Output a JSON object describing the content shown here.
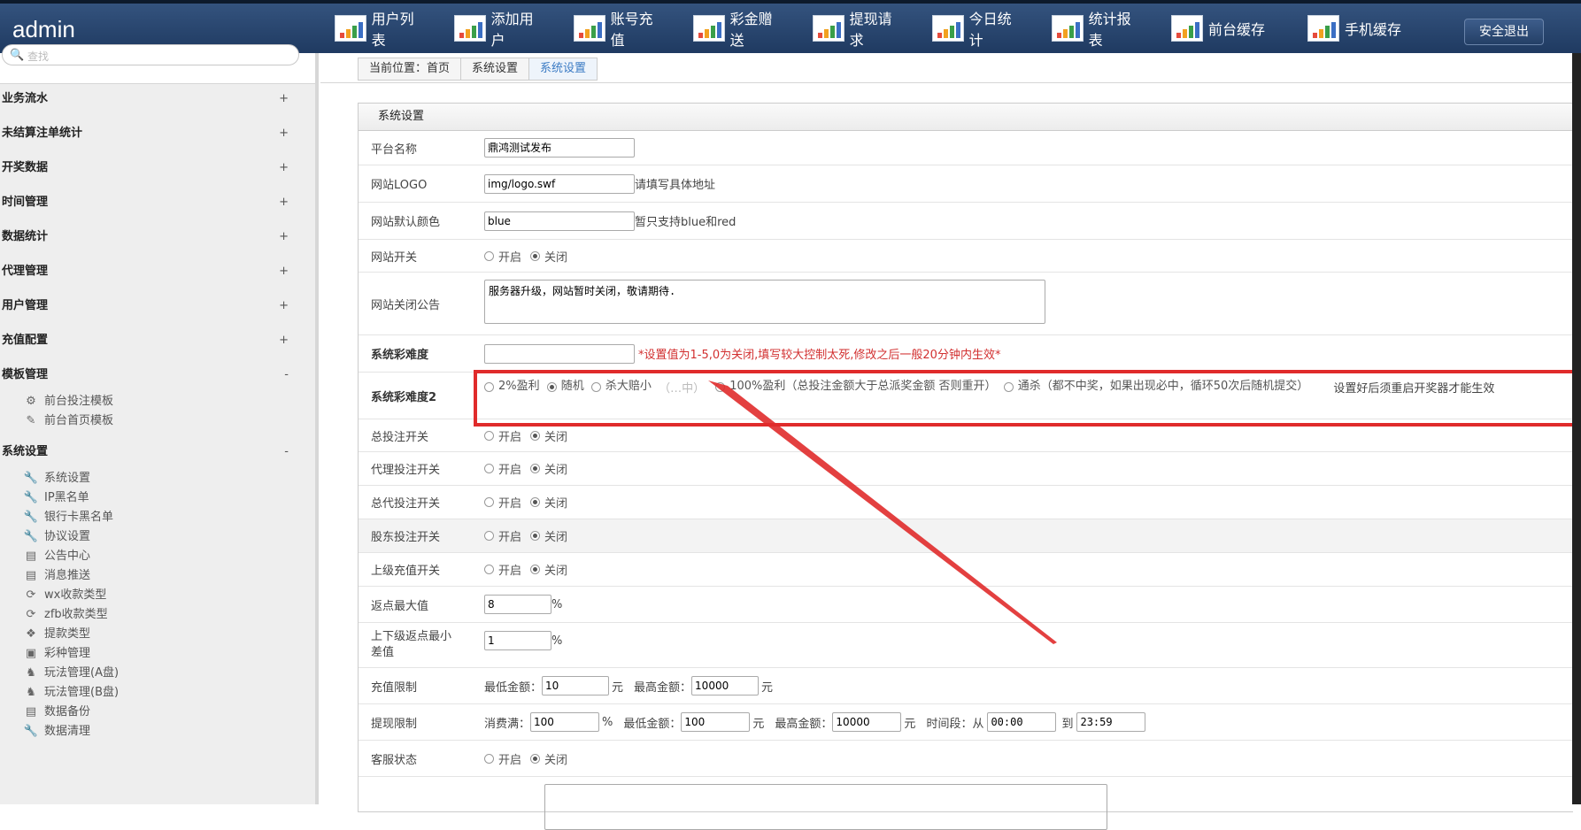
{
  "header": {
    "brand": "admin",
    "nav": [
      "用户列表",
      "添加用户",
      "账号充值",
      "彩金赠送",
      "提现请求",
      "今日统计",
      "统计报表",
      "前台缓存",
      "手机缓存"
    ],
    "logout": "安全退出"
  },
  "sidebar": {
    "search_placeholder": "查找",
    "groups": [
      {
        "label": "业务流水",
        "sign": "+"
      },
      {
        "label": "未结算注单统计",
        "sign": "+"
      },
      {
        "label": "开奖数据",
        "sign": "+"
      },
      {
        "label": "时间管理",
        "sign": "+"
      },
      {
        "label": "数据统计",
        "sign": "+"
      },
      {
        "label": "代理管理",
        "sign": "+"
      },
      {
        "label": "用户管理",
        "sign": "+"
      },
      {
        "label": "充值配置",
        "sign": "+"
      },
      {
        "label": "模板管理",
        "sign": "-"
      }
    ],
    "template_items": [
      "前台投注模板",
      "前台首页模板"
    ],
    "system_group": {
      "label": "系统设置",
      "sign": "-"
    },
    "system_items": [
      "系统设置",
      "IP黑名单",
      "银行卡黑名单",
      "协议设置",
      "公告中心",
      "消息推送",
      "wx收款类型",
      "zfb收款类型",
      "提款类型",
      "彩种管理",
      "玩法管理(A盘)",
      "玩法管理(B盘)",
      "数据备份",
      "数据清理"
    ]
  },
  "breadcrumb": [
    "当前位置：首页",
    "系统设置",
    "系统设置"
  ],
  "panel": {
    "title": "系统设置",
    "platform_name": {
      "label": "平台名称",
      "value": "鼎鸿测试发布"
    },
    "logo": {
      "label": "网站LOGO",
      "value": "img/logo.swf",
      "hint": "请填写具体地址"
    },
    "color": {
      "label": "网站默认颜色",
      "value": "blue",
      "hint": "暂只支持blue和red"
    },
    "site_switch": {
      "label": "网站开关"
    },
    "close_notice": {
      "label": "网站关闭公告",
      "value": "服务器升级，网站暂时关闭，敬请期待."
    },
    "difficulty": {
      "label": "系统彩难度",
      "hint": "*设置值为1-5,0为关闭,填写较大控制太死,修改之后一般20分钟内生效*"
    },
    "difficulty2": {
      "label": "系统彩难度2",
      "opt1": "2%盈利",
      "opt2": "随机",
      "opt3": "杀大赔小",
      "opt3_note": "（…中）",
      "opt4": "100%盈利（总投注金额大于总派奖金额 否则重开）",
      "opt5": "通杀（都不中奖，如果出现必中，循环50次后随机提交）",
      "footnote": "设置好后须重启开奖器才能生效"
    },
    "on": "开启",
    "off": "关闭",
    "total_bet": {
      "label": "总投注开关"
    },
    "agent_bet": {
      "label": "代理投注开关"
    },
    "general_agent_bet": {
      "label": "总代投注开关"
    },
    "shareholder_bet": {
      "label": "股东投注开关"
    },
    "upper_recharge": {
      "label": "上级充值开关"
    },
    "max_rebate": {
      "label": "返点最大值",
      "value": "8",
      "unit": "%"
    },
    "min_rebate_diff": {
      "label": "上下级返点最小差值",
      "value": "1",
      "unit": "%"
    },
    "recharge_limit": {
      "label": "充值限制",
      "min_label": "最低金额：",
      "min": "10",
      "unit": "元",
      "max_label": "最高金额：",
      "max": "10000"
    },
    "withdraw_limit": {
      "label": "提现限制",
      "consume_label": "消费满：",
      "consume": "100",
      "consume_unit": "%",
      "min_label": "最低金额：",
      "min": "100",
      "unit": "元",
      "max_label": "最高金额：",
      "max": "10000",
      "time_label": "时间段：从",
      "from": "00:00",
      "to_label": "到",
      "to": "23:59"
    },
    "cs_status": {
      "label": "客服状态"
    }
  },
  "colors": {
    "header": "#2a4670",
    "accent": "#3b7bc4",
    "highlight": "#e02b2b"
  }
}
